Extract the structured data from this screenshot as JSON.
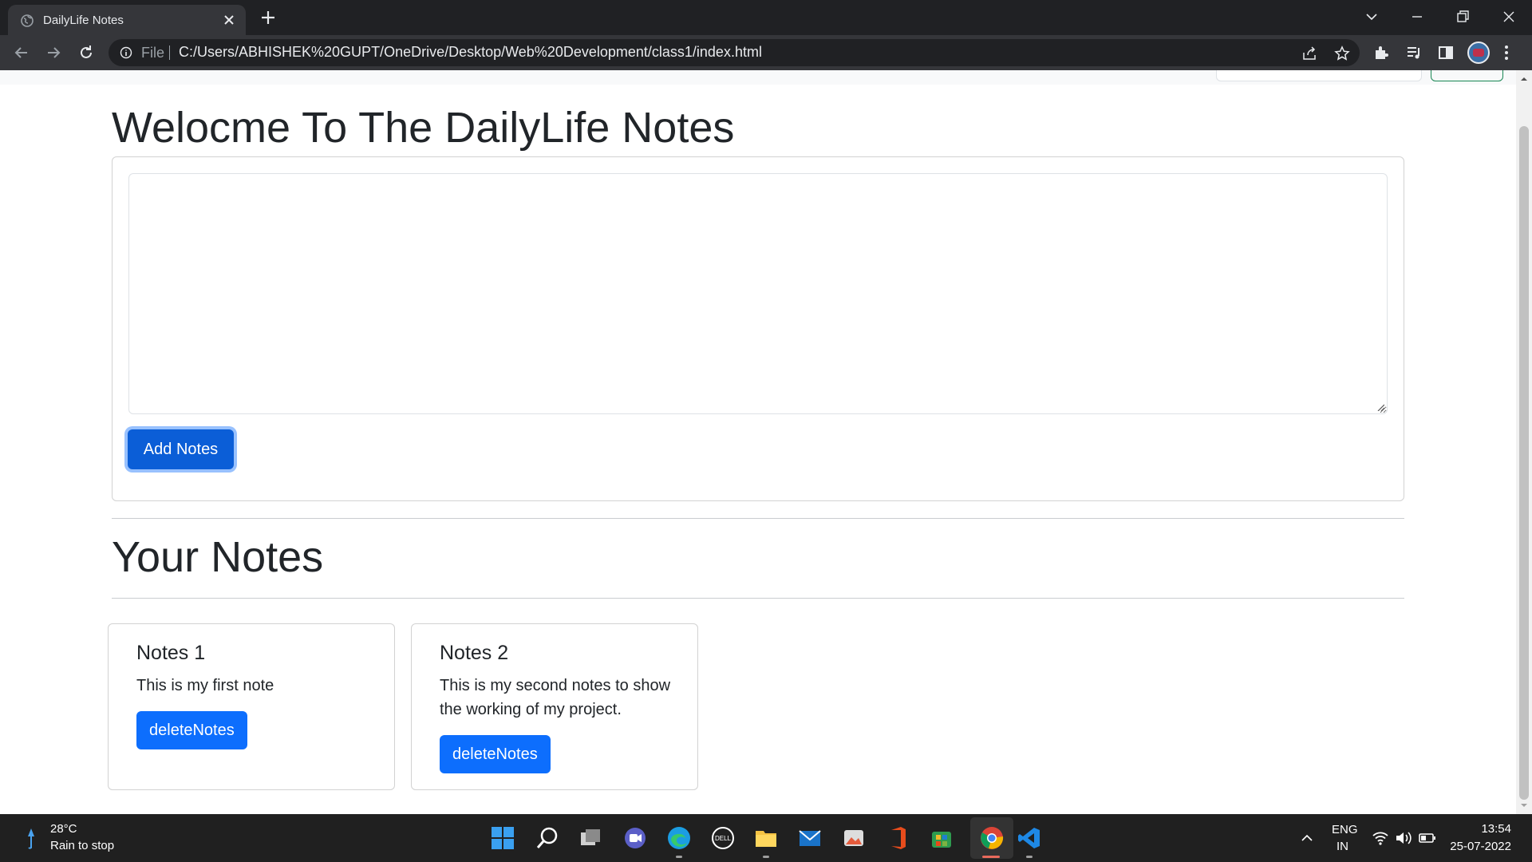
{
  "browser": {
    "tab_title": "DailyLife Notes",
    "address_scheme_label": "File",
    "address_url": "C:/Users/ABHISHEK%20GUPT/OneDrive/Desktop/Web%20Development/class1/index.html"
  },
  "page": {
    "title": "Welocme To The DailyLife Notes",
    "note_input_value": "",
    "add_button_label": "Add Notes",
    "section_title": "Your Notes",
    "notes": [
      {
        "heading": "Notes 1",
        "body": "This is my first note",
        "delete_label": "deleteNotes"
      },
      {
        "heading": "Notes 2",
        "body": "This is my second notes to show the working of my project.",
        "delete_label": "deleteNotes"
      }
    ]
  },
  "taskbar": {
    "weather_temp": "28°C",
    "weather_desc": "Rain to stop",
    "lang_line1": "ENG",
    "lang_line2": "IN",
    "time": "13:54",
    "date": "25-07-2022"
  },
  "colors": {
    "primary_button": "#0d6efd",
    "chrome_dark": "#202124",
    "taskbar": "#202020"
  }
}
